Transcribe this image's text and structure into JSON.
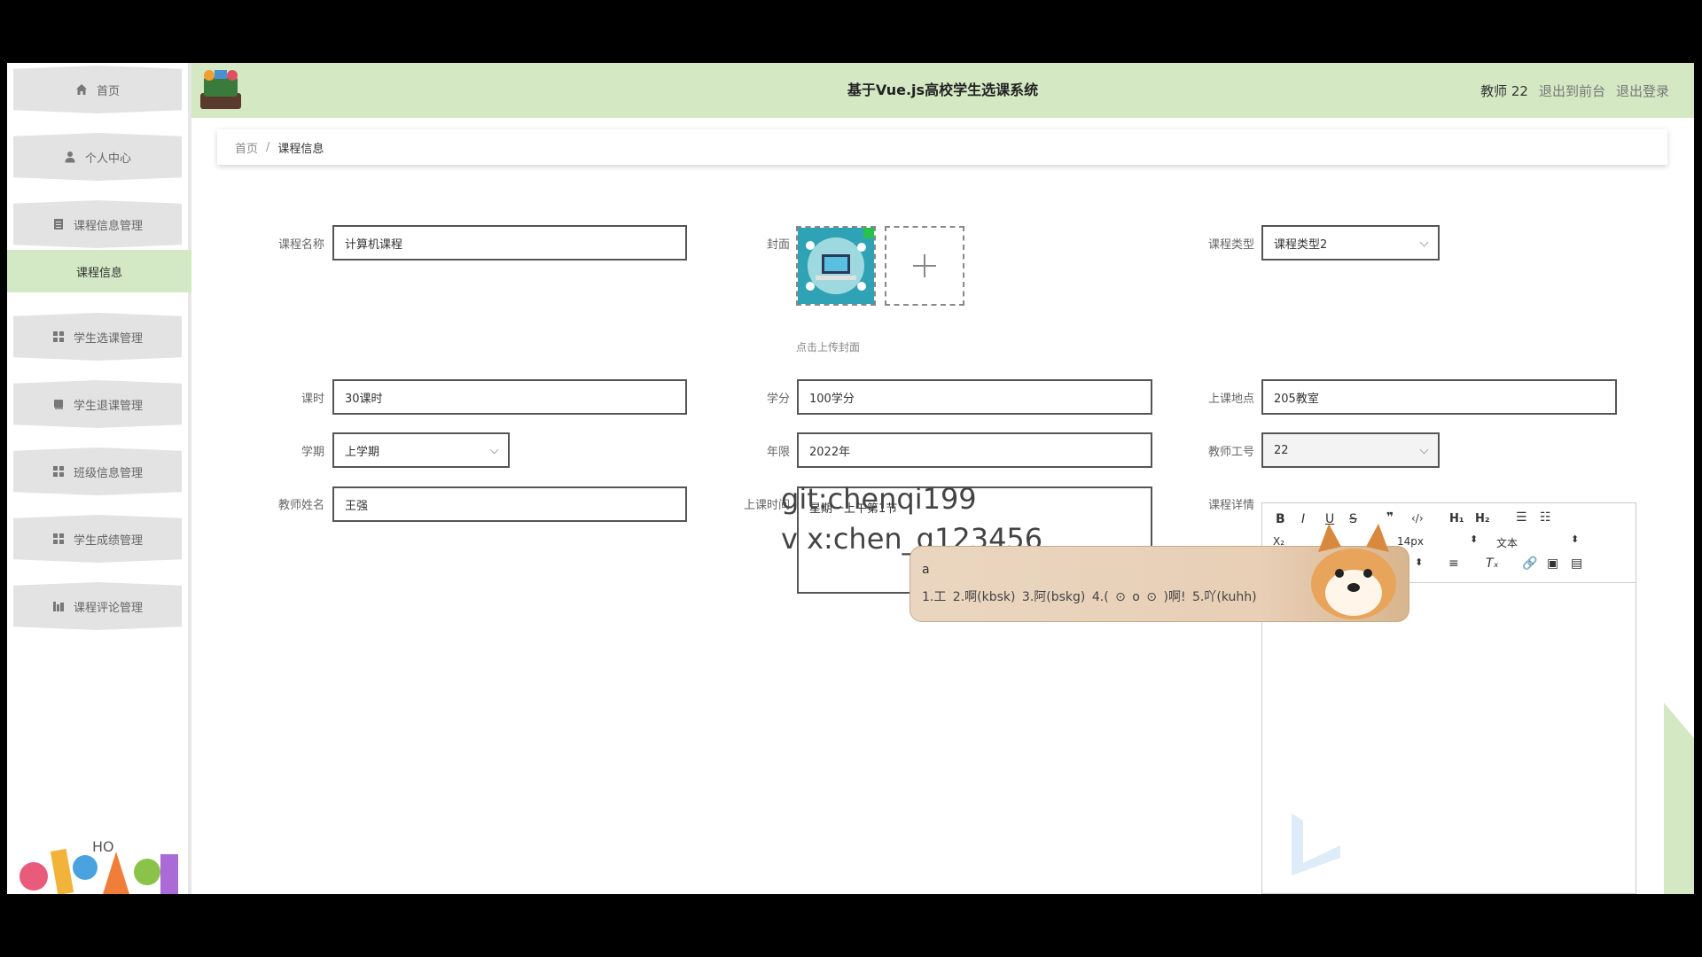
{
  "header": {
    "title": "基于Vue.js高校学生选课系统",
    "user": "教师 22",
    "to_front": "退出到前台",
    "logout": "退出登录"
  },
  "sidebar": {
    "items": [
      {
        "label": "首页",
        "icon": "home-icon"
      },
      {
        "label": "个人中心",
        "icon": "user-icon"
      },
      {
        "label": "课程信息管理",
        "icon": "document-icon"
      },
      {
        "label": "学生选课管理",
        "icon": "grid-icon"
      },
      {
        "label": "学生退课管理",
        "icon": "book-icon"
      },
      {
        "label": "班级信息管理",
        "icon": "grid-icon"
      },
      {
        "label": "学生成绩管理",
        "icon": "grid-icon"
      },
      {
        "label": "课程评论管理",
        "icon": "chart-icon"
      }
    ],
    "active_sub": "课程信息"
  },
  "breadcrumb": {
    "home": "首页",
    "separator": "/",
    "current": "课程信息"
  },
  "form": {
    "course_name_label": "课程名称",
    "course_name": "计算机课程",
    "cover_label": "封面",
    "cover_hint": "点击上传封面",
    "course_type_label": "课程类型",
    "course_type": "课程类型2",
    "hours_label": "课时",
    "hours": "30课时",
    "credit_label": "学分",
    "credit": "100学分",
    "location_label": "上课地点",
    "location": "205教室",
    "term_label": "学期",
    "term": "上学期",
    "year_label": "年限",
    "year": "2022年",
    "teacher_id_label": "教师工号",
    "teacher_id": "22",
    "teacher_name_label": "教师姓名",
    "teacher_name": "王强",
    "time_label": "上课时间",
    "time": "星期一上午第1节",
    "detail_label": "课程详情"
  },
  "editor": {
    "font_size": "14px",
    "block_type": "文本"
  },
  "watermark": {
    "line1": "git:chenqi199",
    "line2": "v x:chen_q123456"
  },
  "ime": {
    "input": "a",
    "candidates": "1.工  2.啊(kbsk)  3.阿(bskg)  4.( ⊙ o ⊙ )啊!   5.吖(kuhh)"
  },
  "colors": {
    "header_bg": "#d4e8c4",
    "active_sub_bg": "#d3e8c4",
    "nav_item_bg": "#e3e3e3"
  }
}
